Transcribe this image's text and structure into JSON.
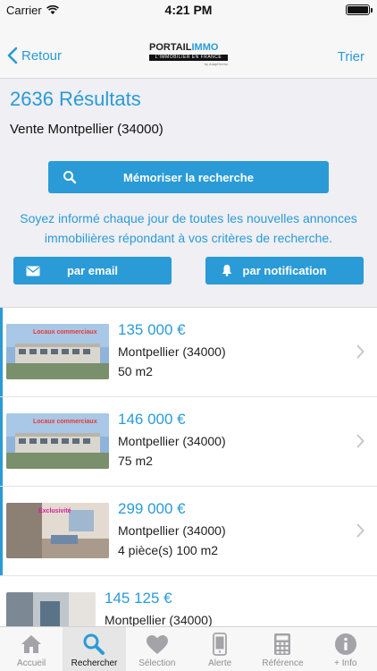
{
  "status_bar": {
    "carrier": "Carrier",
    "time": "4:21 PM"
  },
  "nav": {
    "back_label": "Retour",
    "sort_label": "Trier",
    "logo": {
      "part1": "PORTAIL",
      "part2": "IMMO",
      "tagline": "L'IMMOBILIER EN FRANCE",
      "byline": "by Adapt'immo"
    }
  },
  "header": {
    "results_title": "2636 Résultats",
    "search_description": "Vente Montpellier (34000)",
    "save_search_label": "Mémoriser la recherche",
    "notify_text": "Soyez informé chaque jour de toutes les nouvelles annonces immobilières répondant à vos critères de recherche.",
    "email_label": "par email",
    "notification_label": "par notification"
  },
  "listings": [
    {
      "price": "135 000  €",
      "city": "Montpellier (34000)",
      "details": "50 m2",
      "photo_caption": "Locaux commerciaux"
    },
    {
      "price": "146 000  €",
      "city": "Montpellier (34000)",
      "details": "75 m2",
      "photo_caption": "Locaux commerciaux"
    },
    {
      "price": "299 000  €",
      "city": "Montpellier (34000)",
      "details": "4 pièce(s) 100 m2",
      "photo_caption": "Exclusivité"
    },
    {
      "price": "145 125  €",
      "city": "Montpellier (34000)",
      "details": ""
    }
  ],
  "tabs": [
    {
      "label": "Accueil",
      "icon": "home-icon"
    },
    {
      "label": "Rechercher",
      "icon": "search-icon"
    },
    {
      "label": "Sélection",
      "icon": "heart-icon"
    },
    {
      "label": "Alerte",
      "icon": "phone-icon"
    },
    {
      "label": "Référence",
      "icon": "calculator-icon"
    },
    {
      "label": "+ Info",
      "icon": "info-icon"
    }
  ],
  "colors": {
    "accent": "#2a9bd6",
    "background": "#efeff4",
    "bar": "#f7f7f7"
  }
}
